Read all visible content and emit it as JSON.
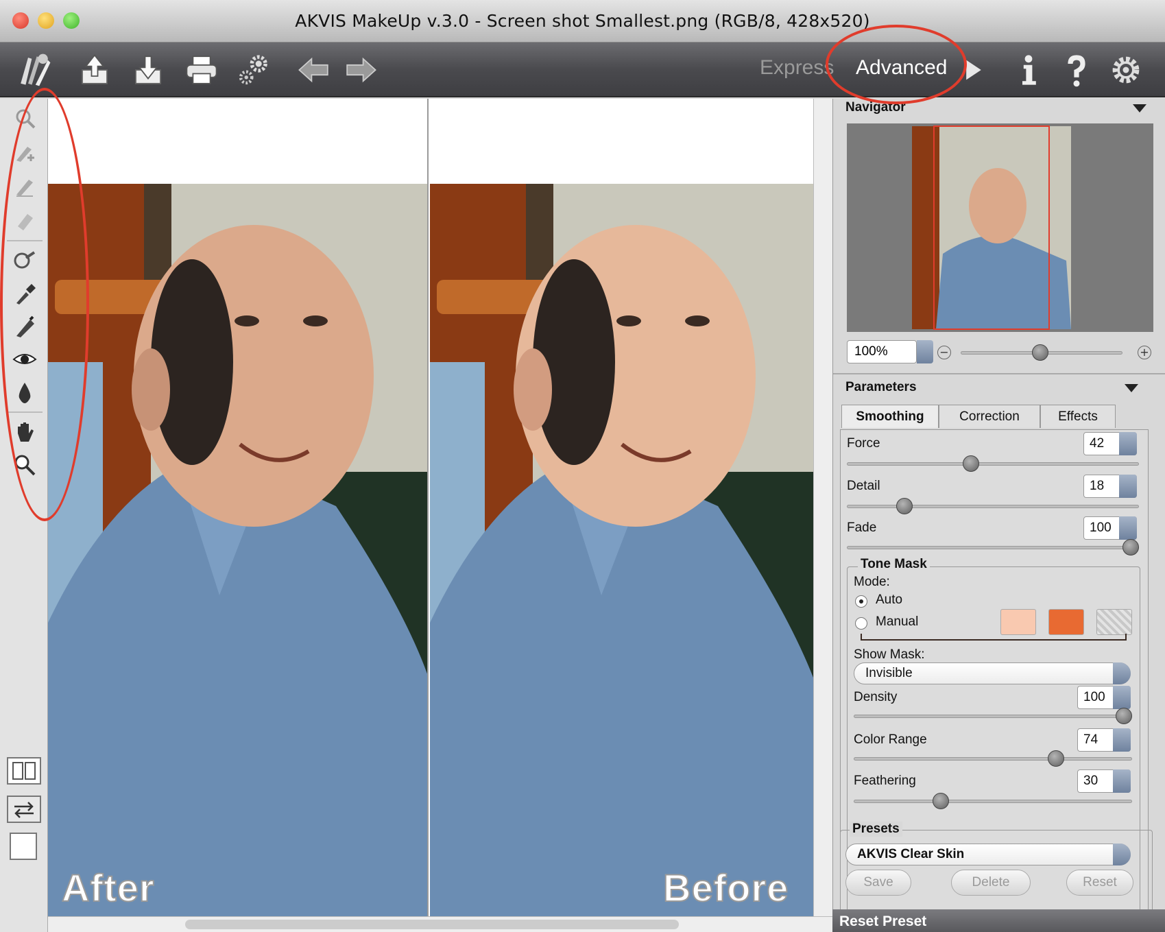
{
  "window": {
    "title": "AKVIS MakeUp v.3.0 - Screen shot Smallest.png (RGB/8, 428x520)"
  },
  "toolbar": {
    "modes": {
      "express": "Express",
      "advanced": "Advanced"
    }
  },
  "canvas": {
    "after_label": "After",
    "before_label": "Before"
  },
  "navigator": {
    "title": "Navigator",
    "zoom": "100%"
  },
  "parameters": {
    "title": "Parameters",
    "tabs": [
      "Smoothing",
      "Correction",
      "Effects"
    ],
    "force": {
      "label": "Force",
      "value": "42",
      "max": 100
    },
    "detail": {
      "label": "Detail",
      "value": "18",
      "max": 100
    },
    "fade": {
      "label": "Fade",
      "value": "100",
      "max": 100
    },
    "tone_mask": {
      "title": "Tone Mask",
      "mode_label": "Mode:",
      "mode_auto": "Auto",
      "mode_manual": "Manual",
      "show_mask_label": "Show Mask:",
      "show_mask_value": "Invisible",
      "density": {
        "label": "Density",
        "value": "100",
        "max": 100
      },
      "color_range": {
        "label": "Color Range",
        "value": "74",
        "max": 100
      },
      "feathering": {
        "label": "Feathering",
        "value": "30",
        "max": 100
      }
    }
  },
  "presets": {
    "title": "Presets",
    "selected": "AKVIS Clear Skin",
    "save": "Save",
    "delete": "Delete",
    "reset": "Reset"
  },
  "status": {
    "text": "Reset Preset"
  },
  "colors": {
    "annotation_ring": "#e03c2c",
    "swatch_light": "#f9c9b0",
    "swatch_dark": "#e86a32"
  }
}
